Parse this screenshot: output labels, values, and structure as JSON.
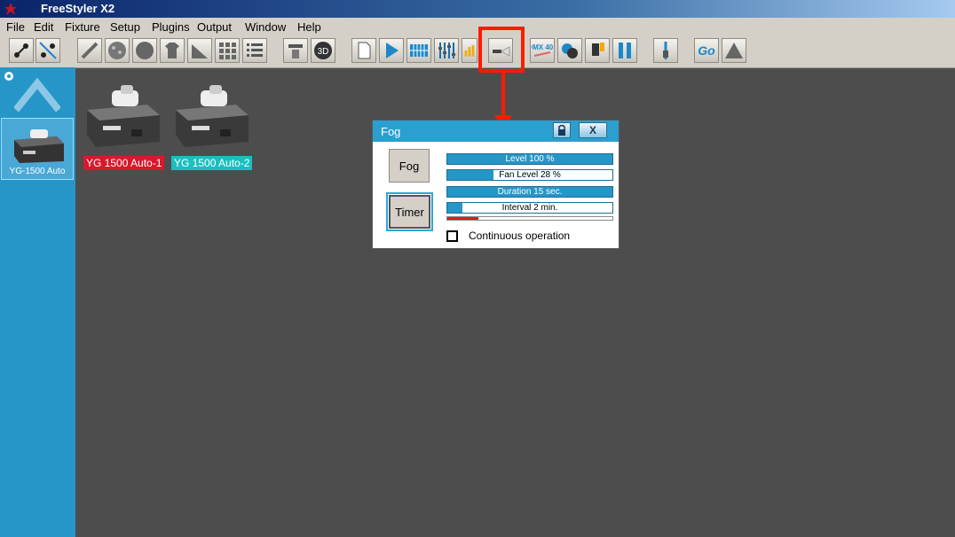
{
  "app": {
    "title": "FreeStyler X2"
  },
  "menu": [
    "File",
    "Edit",
    "Fixture",
    "Setup",
    "Plugins",
    "Output",
    "Window",
    "Help"
  ],
  "toolbar": {
    "icons": [
      "fixture-link-icon",
      "fixture-unlink-icon",
      "pen-icon",
      "gobo-icon",
      "gobo2-icon",
      "tshirt-icon",
      "ramp-icon",
      "grid-icon",
      "list-icon",
      "projector-icon",
      "3d-icon",
      "document-icon",
      "play-icon",
      "sequence-grid-icon",
      "fader-icon",
      "level-icon",
      "fog-machine-icon",
      "dmx-icon",
      "color-wheel-icon",
      "moving-head-icon",
      "pause-icon",
      "slider-icon",
      "go-icon",
      "triangle-icon"
    ],
    "dmx_label": "DMX 400",
    "go_label": "Go",
    "threed_label": "3D"
  },
  "sidebar": {
    "fixture_label": "YG-1500 Auto"
  },
  "fixtures": [
    {
      "label": "YG 1500 Auto-1",
      "color": "#d8182c"
    },
    {
      "label": "YG 1500 Auto-2",
      "color": "#1bbfbf"
    }
  ],
  "fog_window": {
    "title": "Fog",
    "close_label": "X",
    "fog_button": "Fog",
    "timer_button": "Timer",
    "bars": [
      {
        "text": "Level 100 %",
        "value": 1.0
      },
      {
        "text": "Fan Level 28 %",
        "value": 0.28
      },
      {
        "text": "Duration 15 sec.",
        "value": 1.0
      },
      {
        "text": "Interval 2 min.",
        "value": 0.09
      }
    ],
    "progress": 0.19,
    "continuous_label": "Continuous operation",
    "continuous_checked": false
  }
}
